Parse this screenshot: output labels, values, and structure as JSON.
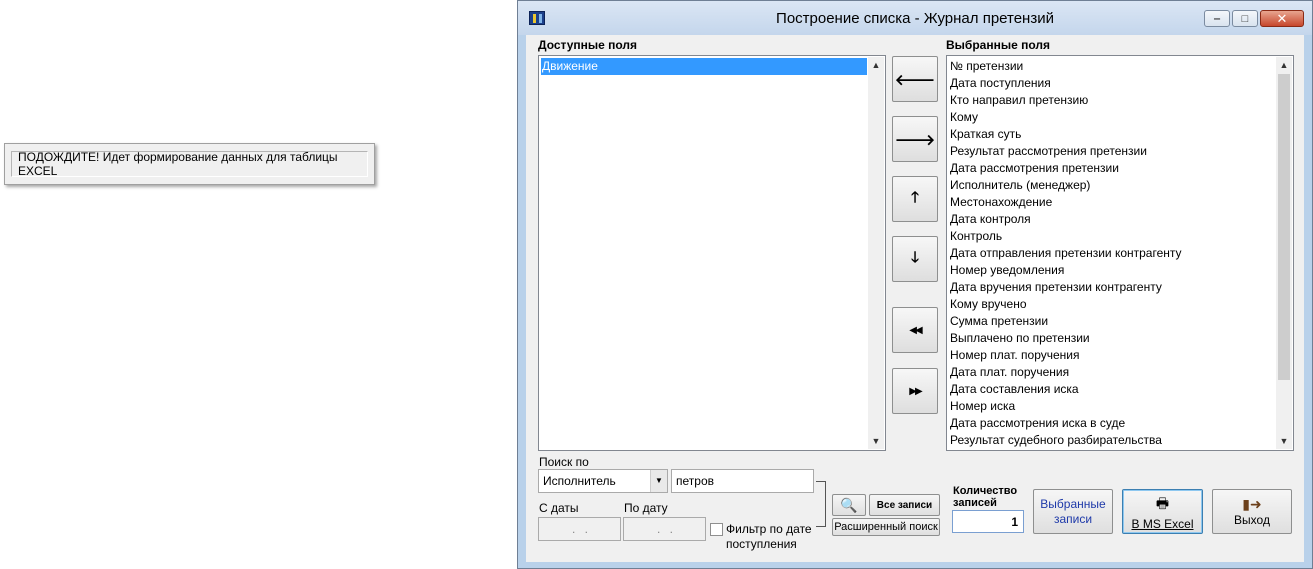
{
  "popup": {
    "message": "ПОДОЖДИТЕ! Идет формирование данных для таблицы EXCEL"
  },
  "window": {
    "title": "Построение списка - Журнал претензий",
    "minimize_glyph": "‒",
    "maximize_glyph": "□",
    "close_glyph": "✕"
  },
  "available": {
    "label": "Доступные поля",
    "items": [
      "Движение"
    ],
    "selected_index": 0
  },
  "selected": {
    "label": "Выбранные поля",
    "items": [
      "№ претензии",
      "Дата поступления",
      "Кто направил претензию",
      "Кому",
      "Краткая суть",
      "Результат рассмотрения претензии",
      "Дата рассмотрения претензии",
      "Исполнитель (менеджер)",
      "Местонахождение",
      "Дата контроля",
      "Контроль",
      "Дата отправления претензии контрагенту",
      "Номер уведомления",
      "Дата вручения претензии контрагенту",
      "Кому вручено",
      "Сумма претензии",
      "Выплачено по претензии",
      "Номер плат. поручения",
      "Дата плат. поручения",
      "Дата составления иска",
      "Номер иска",
      "Дата рассмотрения иска в суде",
      "Результат судебного разбирательства"
    ]
  },
  "move_buttons": {
    "left": "🡐",
    "right": "🡒",
    "up": "🡑",
    "down": "🡓",
    "all_left": "◀◀",
    "all_right": "▶▶"
  },
  "search": {
    "label": "Поиск по",
    "field": "Исполнитель",
    "value": "петров",
    "date_from_label": "С даты",
    "date_to_label": "По дату",
    "date_from_value": ". .",
    "date_to_value": ". .",
    "date_filter_label": "Фильтр по дате поступления",
    "date_filter_checked": false,
    "all_records_label": "Все записи",
    "advanced_search_label": "Расширенный поиск"
  },
  "count": {
    "label": "Количество записей",
    "value": "1"
  },
  "actions": {
    "selected_records_label": "Выбранные записи",
    "ms_excel_label": "В MS Excel",
    "exit_label": "Выход"
  }
}
